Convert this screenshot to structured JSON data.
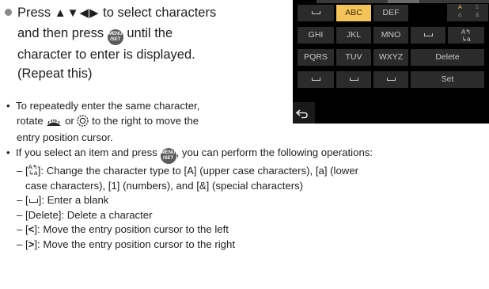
{
  "step": {
    "line1_pre": "Press",
    "arrows": "▲▼◀▶",
    "line1_post": "to select characters",
    "line2_pre": "and then press",
    "line2_post": "until the",
    "line3": "character to enter is displayed.",
    "line4": "(Repeat this)"
  },
  "buttons": {
    "menu_top": "MENU",
    "menu_bottom": "/SET"
  },
  "note_repeat": {
    "line1": "To repeatedly enter the same character,",
    "line2_pre": "rotate",
    "line2_mid": "or",
    "line2_post": "to the right to move the",
    "line3": "entry position cursor."
  },
  "note_ops": {
    "intro_pre": "If you select an item and press",
    "intro_post": ", you can perform the following operations:",
    "item1_a": "– [",
    "item1_glyph_top": "A↰",
    "item1_glyph_bot": "↳a",
    "item1_b": "]: Change the character type to [A] (upper case characters), [a] (lower",
    "item1_c": "case characters), [1] (numbers), and [&] (special characters)",
    "item2_a": "– [",
    "item2_b": "]: Enter a blank",
    "item3": "– [Delete]: Delete a character",
    "item4_a": "– [",
    "item4_glyph": "<",
    "item4_b": "]: Move the entry position cursor to the left",
    "item5_a": "– [",
    "item5_glyph": ">",
    "item5_b": "]: Move the entry position cursor to the right"
  },
  "screen": {
    "row1": [
      "",
      "ABC",
      "DEF"
    ],
    "row2": [
      "GHI",
      "JKL",
      "MNO",
      "",
      ""
    ],
    "row3": [
      "PQRS",
      "TUV",
      "WXYZ",
      "Delete"
    ],
    "row4": [
      "",
      "",
      "",
      "Set"
    ],
    "case_labels": {
      "upper": "A",
      "num": "1",
      "lower": "a",
      "special": "&"
    },
    "toggle_glyph_top": "A↰",
    "toggle_glyph_bot": "↳a",
    "accent": "#f4c35a",
    "key_bg": "#2b2b2b"
  },
  "icons": [
    "menu-set-icon",
    "rear-dial-icon",
    "control-dial-icon",
    "back-icon",
    "space-icon",
    "case-toggle-icon"
  ]
}
